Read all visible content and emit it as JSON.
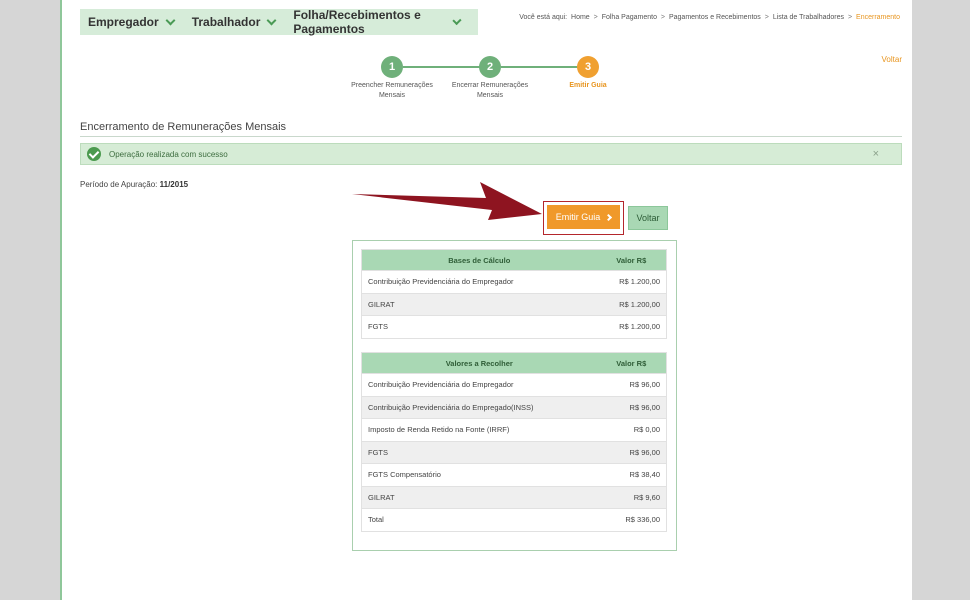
{
  "nav": {
    "items": [
      {
        "label": "Empregador"
      },
      {
        "label": "Trabalhador"
      },
      {
        "label": "Folha/Recebimentos e Pagamentos"
      }
    ]
  },
  "breadcrumb": {
    "prefix": "Você está aqui:",
    "items": [
      "Home",
      "Folha Pagamento",
      "Pagamentos e Recebimentos",
      "Lista de Trabalhadores"
    ],
    "current": "Encerramento",
    "separator": ">"
  },
  "top_voltar": "Voltar",
  "stepper": {
    "steps": [
      {
        "number": "1",
        "label_line1": "Preencher Remunerações",
        "label_line2": "Mensais",
        "state": "done"
      },
      {
        "number": "2",
        "label_line1": "Encerrar Remunerações",
        "label_line2": "Mensais",
        "state": "done"
      },
      {
        "number": "3",
        "label_line1": "Emitir Guia",
        "label_line2": "",
        "state": "active"
      }
    ]
  },
  "page_title": "Encerramento de Remunerações Mensais",
  "alert": {
    "message": "Operação realizada com sucesso",
    "close": "×"
  },
  "periodo": {
    "label": "Período de Apuração:",
    "value": "11/2015"
  },
  "buttons": {
    "emitir": "Emitir Guia",
    "voltar": "Voltar"
  },
  "bases_table": {
    "headers": [
      "Bases de Cálculo",
      "Valor R$"
    ],
    "rows": [
      [
        "Contribuição Previdenciária do Empregador",
        "R$ 1.200,00"
      ],
      [
        "GILRAT",
        "R$ 1.200,00"
      ],
      [
        "FGTS",
        "R$ 1.200,00"
      ]
    ]
  },
  "valores_table": {
    "headers": [
      "Valores a Recolher",
      "Valor R$"
    ],
    "rows": [
      [
        "Contribuição Previdenciária do Empregador",
        "R$ 96,00"
      ],
      [
        "Contribuição Previdenciária do Empregado(INSS)",
        "R$ 96,00"
      ],
      [
        "Imposto de Renda Retido na Fonte (IRRF)",
        "R$ 0,00"
      ],
      [
        "FGTS",
        "R$ 96,00"
      ],
      [
        "FGTS Compensatório",
        "R$ 38,40"
      ],
      [
        "GILRAT",
        "R$ 9,60"
      ],
      [
        "Total",
        "R$ 336,00"
      ]
    ]
  },
  "colors": {
    "accent_green": "#6fb07a",
    "accent_orange": "#f0992a",
    "highlight_red": "#b4262c",
    "header_green": "#a9d8b4"
  }
}
